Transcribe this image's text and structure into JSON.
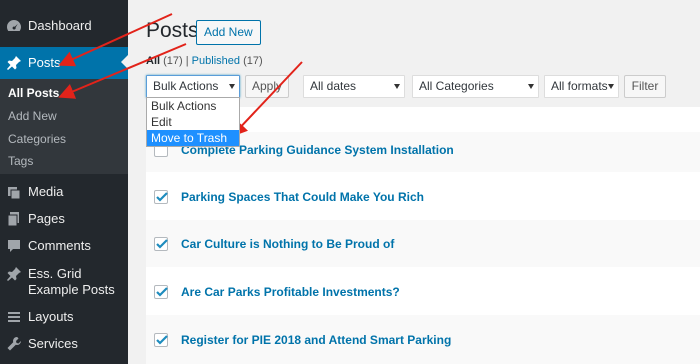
{
  "sidebar": {
    "dashboard": "Dashboard",
    "posts": "Posts",
    "submenu": [
      "All Posts",
      "Add New",
      "Categories",
      "Tags"
    ],
    "media": "Media",
    "pages": "Pages",
    "comments": "Comments",
    "ess_grid": "Ess. Grid Example Posts",
    "layouts": "Layouts",
    "services": "Services"
  },
  "header": {
    "title": "Posts",
    "add_new": "Add New"
  },
  "filters": {
    "all_label": "All",
    "all_count": "(17)",
    "separator": "|",
    "published_label": "Published",
    "published_count": "(17)"
  },
  "toolbar": {
    "bulk_actions": "Bulk Actions",
    "apply": "Apply",
    "dates": "All dates",
    "categories": "All Categories",
    "formats": "All formats",
    "filter": "Filter"
  },
  "bulk_dropdown": {
    "options": [
      "Bulk Actions",
      "Edit",
      "Move to Trash"
    ],
    "selected": "Move to Trash"
  },
  "posts": [
    {
      "title": "Complete Parking Guidance System Installation",
      "checked": false
    },
    {
      "title": "Parking Spaces That Could Make You Rich",
      "checked": true
    },
    {
      "title": "Car Culture is Nothing to Be Proud of",
      "checked": true
    },
    {
      "title": "Are Car Parks Profitable Investments?",
      "checked": true
    },
    {
      "title": "Register for PIE 2018 and Attend Smart Parking",
      "checked": true
    }
  ],
  "colors": {
    "sidebar_bg": "#23282d",
    "active_menu": "#0073aa",
    "link": "#0073aa",
    "annotation_arrow": "#e2231a"
  }
}
